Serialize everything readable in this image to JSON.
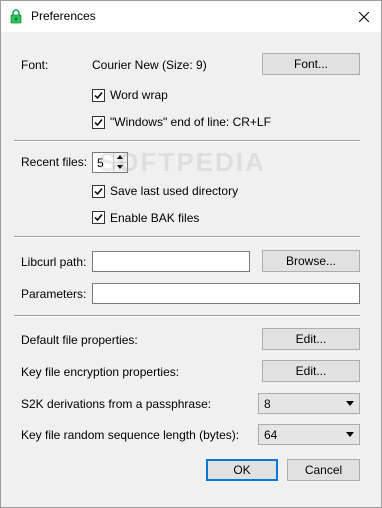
{
  "window": {
    "title": "Preferences",
    "app_icon": "lock-icon",
    "close_icon": "close-icon"
  },
  "font_section": {
    "label": "Font:",
    "value": "Courier New (Size: 9)",
    "button": "Font...",
    "word_wrap": {
      "label": "Word wrap",
      "checked": true
    },
    "windows_eol": {
      "label": "\"Windows\" end of line: CR+LF",
      "checked": true
    }
  },
  "files_section": {
    "recent_label": "Recent files:",
    "recent_value": "5",
    "save_dir": {
      "label": "Save last used directory",
      "checked": true
    },
    "bak_files": {
      "label": "Enable BAK files",
      "checked": true
    }
  },
  "curl_section": {
    "libcurl_label": "Libcurl path:",
    "libcurl_value": "",
    "browse_button": "Browse...",
    "params_label": "Parameters:",
    "params_value": ""
  },
  "props_section": {
    "default_props_label": "Default file properties:",
    "default_props_button": "Edit...",
    "key_enc_label": "Key file encryption properties:",
    "key_enc_button": "Edit...",
    "s2k_label": "S2K derivations from a passphrase:",
    "s2k_value": "8",
    "keylen_label": "Key file random sequence length (bytes):",
    "keylen_value": "64"
  },
  "footer": {
    "ok": "OK",
    "cancel": "Cancel"
  },
  "watermark": "SOFTPEDIA"
}
